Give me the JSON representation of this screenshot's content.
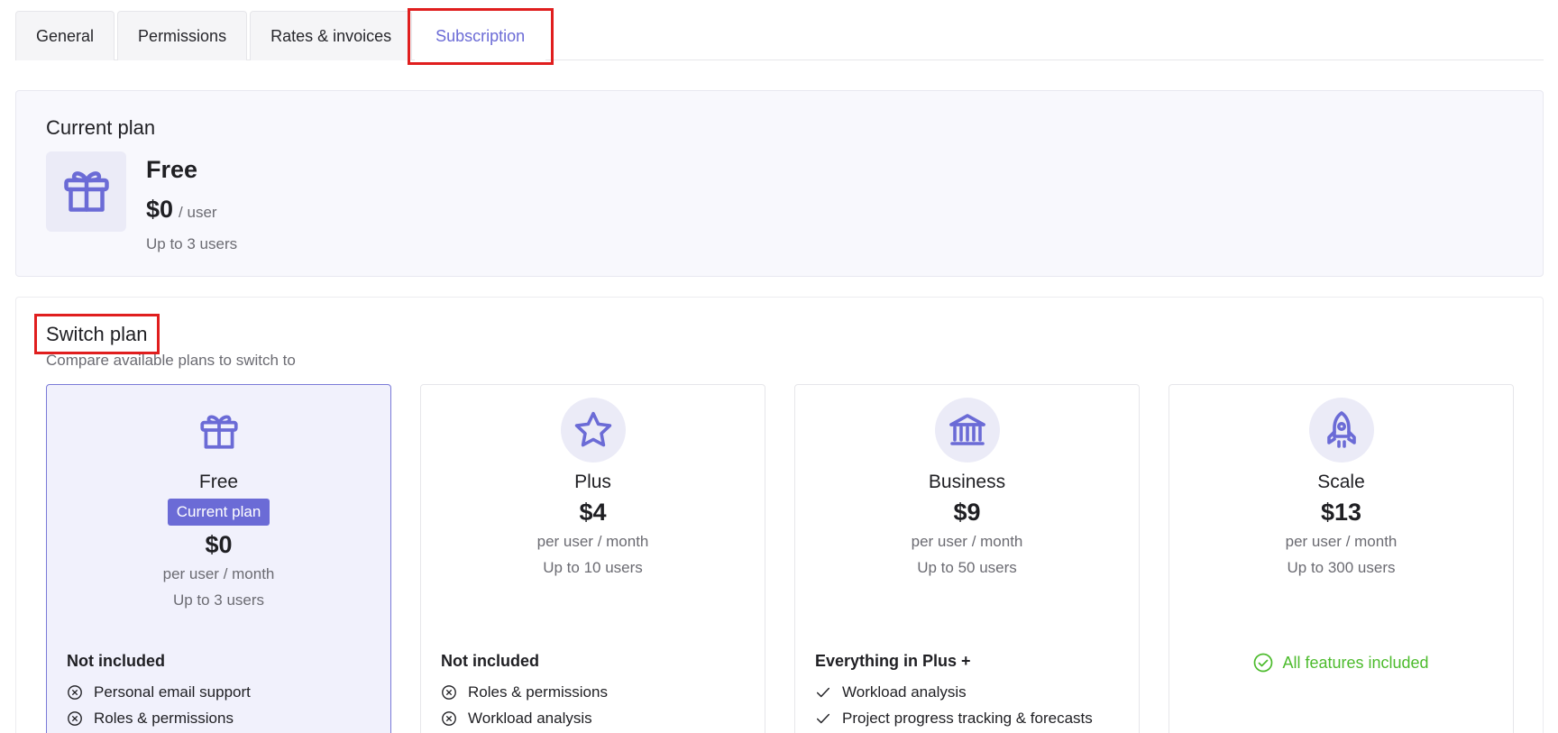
{
  "tabs": [
    {
      "label": "General"
    },
    {
      "label": "Permissions"
    },
    {
      "label": "Rates & invoices"
    },
    {
      "label": "Subscription"
    }
  ],
  "current_plan": {
    "title": "Current plan",
    "name": "Free",
    "price": "$0",
    "unit": "/ user",
    "users": "Up to 3 users",
    "icon": "gift-icon"
  },
  "switch_plan": {
    "title": "Switch plan",
    "subtitle": "Compare available plans to switch to",
    "plans": [
      {
        "name": "Free",
        "icon": "gift-icon",
        "badge": "Current plan",
        "price": "$0",
        "period": "per user / month",
        "users": "Up to 3 users",
        "features_title": "Not included",
        "features": [
          "Personal email support",
          "Roles & permissions"
        ]
      },
      {
        "name": "Plus",
        "icon": "star-icon",
        "price": "$4",
        "period": "per user / month",
        "users": "Up to 10 users",
        "features_title": "Not included",
        "features": [
          "Roles & permissions",
          "Workload analysis"
        ]
      },
      {
        "name": "Business",
        "icon": "bank-icon",
        "price": "$9",
        "period": "per user / month",
        "users": "Up to 50 users",
        "features_title": "Everything in Plus +",
        "features": [
          "Workload analysis",
          "Project progress tracking & forecasts"
        ]
      },
      {
        "name": "Scale",
        "icon": "rocket-icon",
        "price": "$13",
        "period": "per user / month",
        "users": "Up to 300 users",
        "all_included": "All features included"
      }
    ]
  },
  "colors": {
    "accent": "#6b6bd6",
    "success": "#4cbb2c",
    "highlight": "#e01e1e"
  }
}
